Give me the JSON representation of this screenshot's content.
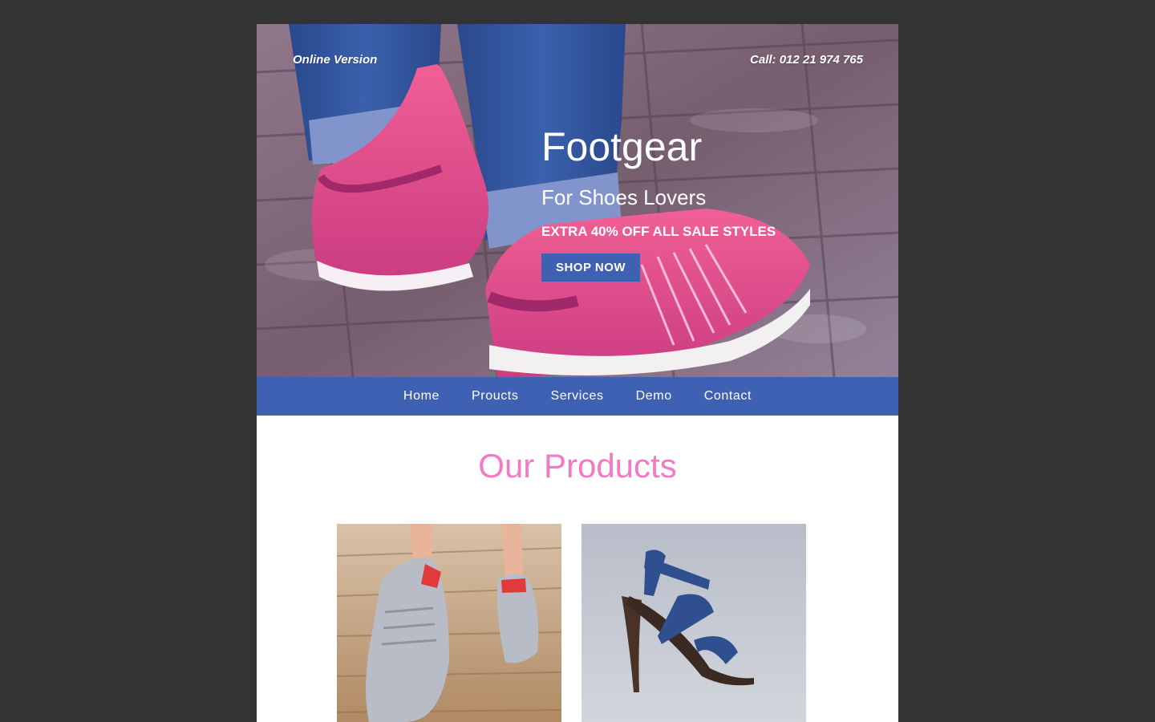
{
  "hero": {
    "online_version": "Online Version",
    "phone": "Call: 012 21 974 765",
    "title": "Footgear",
    "subtitle": "For Shoes Lovers",
    "promo": "EXTRA 40% OFF ALL SALE STYLES",
    "cta_label": "SHOP NOW",
    "image": "pink-sneakers-on-brick-photo"
  },
  "nav": {
    "items": [
      "Home",
      "Proucts",
      "Services",
      "Demo",
      "Contact"
    ]
  },
  "products": {
    "title": "Our Products",
    "items": [
      {
        "image": "grey-running-shoes-photo"
      },
      {
        "image": "blue-strappy-heel-sandal-photo"
      }
    ]
  },
  "colors": {
    "page_bg": "#333333",
    "accent_blue": "#3e61b3",
    "heading_pink": "#f27ac4"
  }
}
